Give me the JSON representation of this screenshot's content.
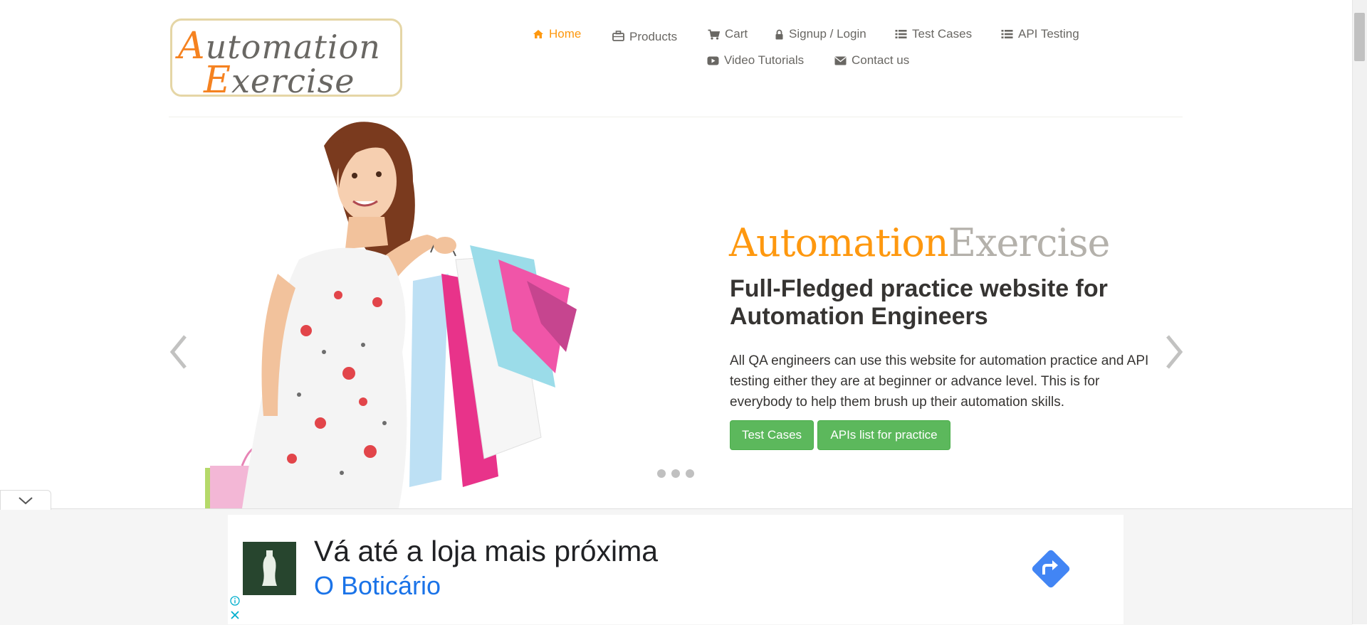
{
  "logo": {
    "line1_cap": "A",
    "line1_rest": "utomation",
    "line2_cap": "E",
    "line2_rest": "xercise"
  },
  "nav": {
    "items": [
      {
        "label": "Home",
        "icon": "home-icon",
        "active": true
      },
      {
        "label": "Products",
        "icon": "briefcase-icon"
      },
      {
        "label": "Cart",
        "icon": "cart-icon"
      },
      {
        "label": "Signup / Login",
        "icon": "lock-icon"
      },
      {
        "label": "Test Cases",
        "icon": "list-icon"
      },
      {
        "label": "API Testing",
        "icon": "list-icon"
      },
      {
        "label": "Video Tutorials",
        "icon": "youtube-icon"
      },
      {
        "label": "Contact us",
        "icon": "envelope-icon"
      }
    ]
  },
  "slider": {
    "brand_part1": "Automation",
    "brand_part2": "Exercise",
    "headline": "Full-Fledged practice website for Automation Engineers",
    "description": "All QA engineers can use this website for automation practice and API testing either they are at beginner or advance level. This is for everybody to help them brush up their automation skills.",
    "button1": "Test Cases",
    "button2": "APIs list for practice",
    "slide_count": 3
  },
  "ad": {
    "title": "Vá até a loja mais próxima",
    "advertiser": "O Boticário"
  },
  "colors": {
    "accent": "#fe980f",
    "button": "#5cb85c",
    "ad_link": "#1a73e8"
  }
}
